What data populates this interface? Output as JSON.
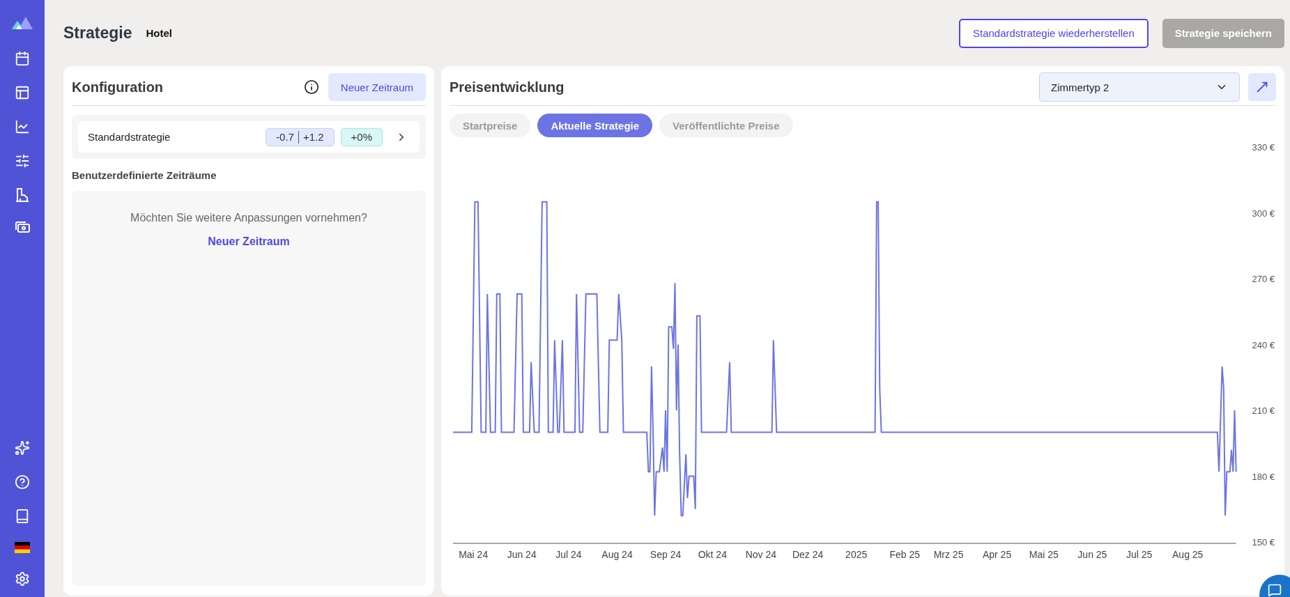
{
  "header": {
    "title": "Strategie",
    "subtitle": "Hotel",
    "buttons": [
      {
        "label": "Standardstrategie wiederherstellen",
        "kind": "outline"
      },
      {
        "label": "Strategie speichern",
        "kind": "primary",
        "disabled": true
      }
    ]
  },
  "config": {
    "title": "Konfiguration",
    "new_button": "Neuer Zeitraum",
    "default_strategy": {
      "label": "Standardstrategie",
      "low": "-0.7",
      "high": "+1.2",
      "percent": "+0%"
    },
    "custom_title": "Benutzerdefinierte Zeiträume",
    "empty_text": "Möchten Sie weitere Anpassungen vornehmen?",
    "empty_link": "Neuer Zeitraum"
  },
  "price": {
    "title": "Preisentwicklung",
    "room_select": "Zimmertyp 2",
    "tabs": [
      {
        "label": "Startpreise",
        "selected": false
      },
      {
        "label": "Aktuelle Strategie",
        "selected": true
      },
      {
        "label": "Veröffentlichte Preise",
        "selected": false
      }
    ],
    "chart_data": {
      "type": "line",
      "xlim": [
        "2024-04-18",
        "2025-09-01"
      ],
      "ylim": [
        150,
        330
      ],
      "yticks": [
        {
          "value": 150,
          "label": "150 €"
        },
        {
          "value": 180,
          "label": "180 €"
        },
        {
          "value": 210,
          "label": "210 €"
        },
        {
          "value": 240,
          "label": "240 €"
        },
        {
          "value": 270,
          "label": "270 €"
        },
        {
          "value": 300,
          "label": "300 €"
        },
        {
          "value": 330,
          "label": "330 €"
        }
      ],
      "xticks": [
        {
          "value": "2024-05-01",
          "label": "Mai 24"
        },
        {
          "value": "2024-06-01",
          "label": "Jun 24"
        },
        {
          "value": "2024-07-01",
          "label": "Jul 24"
        },
        {
          "value": "2024-08-01",
          "label": "Aug 24"
        },
        {
          "value": "2024-09-01",
          "label": "Sep 24"
        },
        {
          "value": "2024-10-01",
          "label": "Okt 24"
        },
        {
          "value": "2024-11-01",
          "label": "Nov 24"
        },
        {
          "value": "2024-12-01",
          "label": "Dez 24"
        },
        {
          "value": "2025-01-01",
          "label": "2025"
        },
        {
          "value": "2025-02-01",
          "label": "Feb 25"
        },
        {
          "value": "2025-03-01",
          "label": "Mrz 25"
        },
        {
          "value": "2025-04-01",
          "label": "Apr 25"
        },
        {
          "value": "2025-05-01",
          "label": "Mai 25"
        },
        {
          "value": "2025-06-01",
          "label": "Jun 25"
        },
        {
          "value": "2025-07-01",
          "label": "Jul 25"
        },
        {
          "value": "2025-08-01",
          "label": "Aug 25"
        }
      ],
      "x": [
        "2024-04-18",
        "2024-04-30",
        "2024-05-02",
        "2024-05-04",
        "2024-05-06",
        "2024-05-09",
        "2024-05-10",
        "2024-05-12",
        "2024-05-15",
        "2024-05-16",
        "2024-05-18",
        "2024-05-19",
        "2024-05-27",
        "2024-05-29",
        "2024-06-01",
        "2024-06-02",
        "2024-06-06",
        "2024-06-07",
        "2024-06-09",
        "2024-06-12",
        "2024-06-14",
        "2024-06-17",
        "2024-06-18",
        "2024-06-21",
        "2024-06-22",
        "2024-06-24",
        "2024-06-25",
        "2024-06-27",
        "2024-06-28",
        "2024-07-01",
        "2024-07-05",
        "2024-07-06",
        "2024-07-08",
        "2024-07-10",
        "2024-07-12",
        "2024-07-19",
        "2024-07-21",
        "2024-07-26",
        "2024-07-27",
        "2024-08-01",
        "2024-08-02",
        "2024-08-04",
        "2024-08-05",
        "2024-08-20",
        "2024-08-21",
        "2024-08-22",
        "2024-08-23",
        "2024-08-24",
        "2024-08-25",
        "2024-08-26",
        "2024-08-28",
        "2024-08-30",
        "2024-08-31",
        "2024-09-01",
        "2024-09-02",
        "2024-09-03",
        "2024-09-05",
        "2024-09-06",
        "2024-09-07",
        "2024-09-08",
        "2024-09-09",
        "2024-09-10",
        "2024-09-11",
        "2024-09-12",
        "2024-09-14",
        "2024-09-15",
        "2024-09-16",
        "2024-09-19",
        "2024-09-20",
        "2024-09-21",
        "2024-09-23",
        "2024-09-24",
        "2024-10-10",
        "2024-10-12",
        "2024-10-13",
        "2024-11-08",
        "2024-11-09",
        "2024-11-11",
        "2025-01-13",
        "2025-01-14",
        "2025-01-15",
        "2025-01-16",
        "2025-01-17",
        "2025-08-20",
        "2025-08-21",
        "2025-08-23",
        "2025-08-24",
        "2025-08-25",
        "2025-08-26",
        "2025-08-28",
        "2025-08-29",
        "2025-08-30",
        "2025-08-31",
        "2025-09-01"
      ],
      "series": [
        {
          "color": "#6c74e4",
          "values": [
            200,
            200,
            305,
            305,
            200,
            200,
            263,
            200,
            200,
            263,
            263,
            200,
            200,
            263,
            263,
            200,
            200,
            232,
            200,
            200,
            305,
            305,
            200,
            200,
            242,
            200,
            200,
            242,
            200,
            200,
            200,
            263,
            200,
            200,
            263,
            263,
            200,
            200,
            242,
            242,
            263,
            242,
            200,
            200,
            182,
            182,
            230,
            200,
            162,
            182,
            182,
            193,
            182,
            210,
            182,
            248,
            248,
            238,
            268,
            210,
            240,
            190,
            162,
            162,
            190,
            170,
            180,
            180,
            165,
            253,
            253,
            200,
            200,
            232,
            200,
            200,
            242,
            200,
            200,
            305,
            305,
            220,
            200,
            200,
            182,
            230,
            220,
            162,
            182,
            182,
            192,
            182,
            210,
            182
          ]
        }
      ]
    }
  }
}
